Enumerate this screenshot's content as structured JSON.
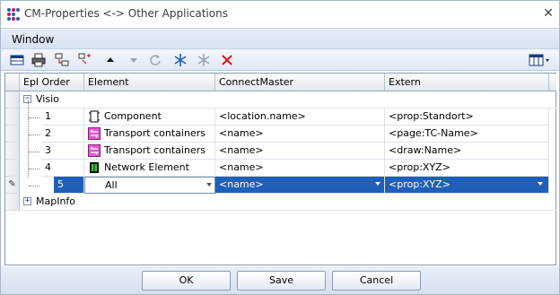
{
  "window": {
    "title": "CM-Properties <-> Other Applications",
    "close_glyph": "✕"
  },
  "menu": {
    "window_label": "Window"
  },
  "toolbar": {
    "icons": [
      "table-view-icon",
      "print-icon",
      "export-icon",
      "import-icon",
      "move-up-icon",
      "move-down-icon",
      "refresh-icon",
      "snowflake-icon",
      "snowflake-gray-icon",
      "delete-icon",
      "layout-dropdown-icon"
    ]
  },
  "grid": {
    "columns": [
      "Epl Order",
      "Element",
      "ConnectMaster",
      "Extern"
    ],
    "groups": [
      {
        "label": "Visio",
        "expander": "−"
      },
      {
        "label": "MapInfo",
        "expander": "+"
      }
    ],
    "rows": [
      {
        "order": "1",
        "element": "Component",
        "connect": "<location.name>",
        "extern": "<prop:Standort>",
        "icon": "component-icon"
      },
      {
        "order": "2",
        "element": "Transport containers",
        "connect": "<name>",
        "extern": "<page:TC-Name>",
        "icon": "transport-icon"
      },
      {
        "order": "3",
        "element": "Transport containers",
        "connect": "<name>",
        "extern": "<draw:Name>",
        "icon": "transport-icon"
      },
      {
        "order": "4",
        "element": "Network Element",
        "connect": "<name>",
        "extern": "<prop:XYZ>",
        "icon": "network-element-icon"
      },
      {
        "order": "5",
        "element": "All",
        "connect": "<name>",
        "extern": "<prop:XYZ>",
        "icon": ""
      }
    ],
    "edit_indicator": "✎"
  },
  "buttons": {
    "ok": "OK",
    "save": "Save",
    "cancel": "Cancel"
  },
  "colors": {
    "selection": "#1f5fb8",
    "accent": "#d6e2f2"
  }
}
